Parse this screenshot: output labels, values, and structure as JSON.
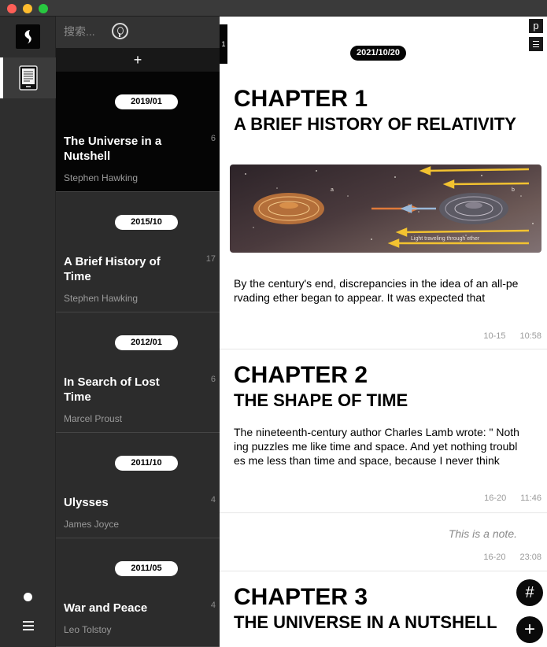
{
  "rail": {
    "logo_icon": "feather-logo-icon",
    "book_icon": "ereader-icon",
    "bottom_icons": [
      "circle-icon",
      "menu-icon"
    ]
  },
  "search": {
    "placeholder": "搜索..."
  },
  "add_label": "+",
  "books": [
    {
      "date": "2019/01",
      "title": "The Universe in a Nutshell",
      "author": "Stephen Hawking",
      "count": "6",
      "active": true
    },
    {
      "date": "2015/10",
      "title": "A Brief History of Time",
      "author": "Stephen Hawking",
      "count": "17",
      "active": false
    },
    {
      "date": "2012/01",
      "title": "In Search of Lost Time",
      "author": "Marcel Proust",
      "count": "6",
      "active": false
    },
    {
      "date": "2011/10",
      "title": "Ulysses",
      "author": "James Joyce",
      "count": "4",
      "active": false
    },
    {
      "date": "2011/05",
      "title": "War and Peace",
      "author": "Leo Tolstoy",
      "count": "4",
      "active": false
    }
  ],
  "handle_label": "1",
  "pane": {
    "date": "2021/10/20",
    "p_label": "p",
    "illustration_caption": "Light traveling through ether",
    "cards": [
      {
        "chapter": "CHAPTER 1",
        "subtitle": "A BRIEF HISTORY OF RELATIVITY",
        "excerpt": "By the century's end, discrepancies in the idea of an all-pervading ether began to appear. It was expected that",
        "pages": "10-15",
        "time": "10:58"
      },
      {
        "chapter": "CHAPTER 2",
        "subtitle": "THE SHAPE OF TIME",
        "excerpt": "The nineteenth-century author Charles Lamb wrote: \" Nothing puzzles me like time and space. And yet nothing troubles me less than time and space, because I never think",
        "pages": "16-20",
        "time": "11:46"
      },
      {
        "note": "This is a note.",
        "pages": "16-20",
        "time": "23:08"
      },
      {
        "chapter": "CHAPTER 3",
        "subtitle": "THE UNIVERSE IN A NUTSHELL"
      }
    ]
  },
  "fab": {
    "hash_label": "#",
    "add_label": "+"
  },
  "colors": {
    "accent": "#050505",
    "sidebar": "#2f2f2f",
    "text_muted": "#9a9a9a"
  }
}
